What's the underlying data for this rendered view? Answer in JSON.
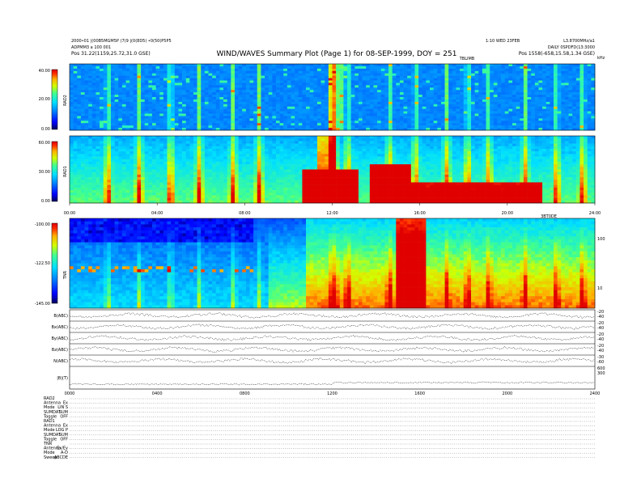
{
  "header": {
    "left_line1": "2000•01 |(00B5MGM5P (7(9 |(0(8D5) •0(50(P5P5",
    "left_line2": "ADPMM3 a 100 001",
    "left_line3": "Pos   31.22(1159,25.72,31.0 GSE)",
    "title": "WIND/WAVES Summary Plot (Page 1) for 08-SEP-1999, DOY = 251",
    "right_line1": "1:10 WED 23FEB",
    "right_line1b": "L3.8700MHz/a1",
    "right_line2": "DAILY 0SPDFD(13:3000",
    "right_line3": "Pos   1558(-658,15.58,1.34 GSE)",
    "rad2_top_label": "TBLIMB",
    "tnr_top_label": "3BT0DE",
    "rad2_right_unit": "kHz"
  },
  "colorbar": {
    "colors": [
      "#00005a",
      "#0000ff",
      "#0080ff",
      "#00e0ff",
      "#40ff90",
      "#d0ff00",
      "#ffb000",
      "#ff3000",
      "#e00000"
    ]
  },
  "chart_data": [
    {
      "type": "heatmap",
      "name": "RAD2",
      "ylabel": "RAD2",
      "color_ticks": [
        "40.00",
        "20.00",
        "0.00"
      ]
    },
    {
      "type": "heatmap",
      "name": "RAD1",
      "ylabel": "RAD1",
      "color_ticks": [
        "60.00",
        "30.00",
        "0.00"
      ],
      "x_ticks": [
        "00:00",
        "04:00",
        "08:00",
        "12:00",
        "16:00",
        "20:00",
        "24:00"
      ]
    },
    {
      "type": "heatmap",
      "name": "TNR",
      "ylabel": "TNR",
      "color_ticks": [
        "-100.00",
        "-122.50",
        "-145.00"
      ],
      "right_ticks": [
        "100",
        "10"
      ]
    },
    {
      "type": "line",
      "name": "magnetic field traces",
      "series": [
        {
          "name": "B(ABC)",
          "right_ticks": [
            "-20",
            "-40"
          ]
        },
        {
          "name": "Bx(ABC)",
          "right_ticks": [
            "-20",
            "-40"
          ]
        },
        {
          "name": "By(ABC)",
          "right_ticks": [
            "-20",
            "-40"
          ]
        },
        {
          "name": "Bz(ABC)",
          "right_ticks": [
            "-20",
            "-40"
          ]
        },
        {
          "name": "N(ABC)",
          "right_ticks": [
            "-30",
            "-60"
          ]
        },
        {
          "name": "|B|(T)",
          "right_ticks": [
            "600",
            "300"
          ]
        }
      ],
      "x_ticks": [
        "0000",
        "0400",
        "0800",
        "1200",
        "1600",
        "2000",
        "2400"
      ]
    }
  ],
  "footer": {
    "rows": [
      {
        "k": "RAD2",
        "v": ""
      },
      {
        "k": "Antenna",
        "v": "Ex"
      },
      {
        "k": "Mode",
        "v": "LIN S"
      },
      {
        "k": "SUMDAT",
        "v": "SUM"
      },
      {
        "k": "Toggle",
        "v": "OFF"
      },
      {
        "k": "RAD1",
        "v": ""
      },
      {
        "k": "Antenna",
        "v": "Ex"
      },
      {
        "k": "Mode",
        "v": "LOG P"
      },
      {
        "k": "SUMDAT",
        "v": "SUM"
      },
      {
        "k": "Toggle",
        "v": "OFF"
      },
      {
        "k": "TNR",
        "v": ""
      },
      {
        "k": "Antenna",
        "v": "Ex/Ey"
      },
      {
        "k": "Mode",
        "v": "A-D"
      },
      {
        "k": "Sweep",
        "v": "ABCDE"
      }
    ]
  }
}
